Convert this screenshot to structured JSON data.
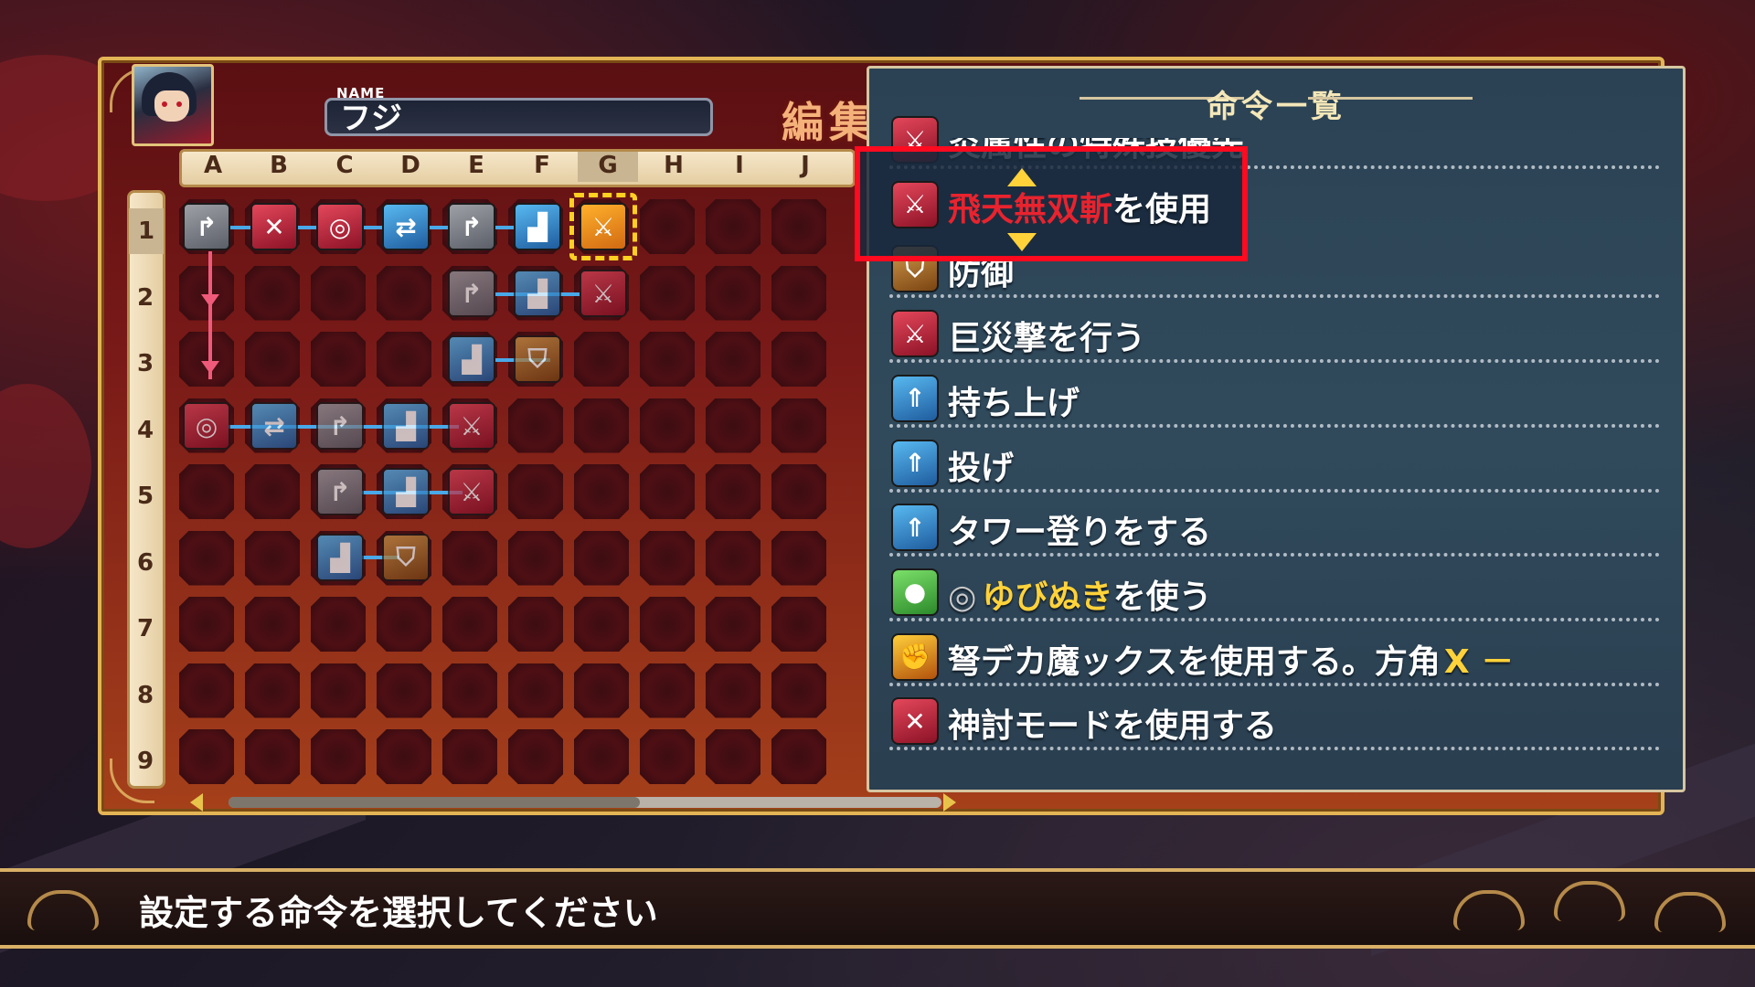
{
  "editor": {
    "name_label": "NAME",
    "name_value": "フジ",
    "title": "編集",
    "columns": [
      "A",
      "B",
      "C",
      "D",
      "E",
      "F",
      "G",
      "H",
      "I",
      "J"
    ],
    "rows": [
      "1",
      "2",
      "3",
      "4",
      "5",
      "6",
      "7",
      "8",
      "9"
    ],
    "selected_cell": "G1"
  },
  "command_list": {
    "title": "命令一覧",
    "items": [
      {
        "icon": "sword-icon",
        "prefix": "",
        "highlight": "",
        "text": "炎属性の特殊技優先"
      },
      {
        "icon": "sword-icon",
        "prefix": "",
        "highlight": "飛天無双斬",
        "text": "を使用"
      },
      {
        "icon": "shield-icon",
        "prefix": "",
        "highlight": "",
        "text": "防御"
      },
      {
        "icon": "sword-icon",
        "prefix": "",
        "highlight": "",
        "text": "巨災撃を行う"
      },
      {
        "icon": "lift-icon",
        "prefix": "",
        "highlight": "",
        "text": "持ち上げ"
      },
      {
        "icon": "lift-icon",
        "prefix": "",
        "highlight": "",
        "text": "投げ"
      },
      {
        "icon": "lift-icon",
        "prefix": "",
        "highlight": "",
        "text": "タワー登りをする"
      },
      {
        "icon": "bag-icon",
        "prefix": "",
        "highlight": "ゆびぬき",
        "text": "を使う"
      },
      {
        "icon": "muscle-icon",
        "prefix": "",
        "highlight": "",
        "text": "弩デカ魔ックスを使用する。方角",
        "suffix": "X －"
      },
      {
        "icon": "god-mode-icon",
        "prefix": "",
        "highlight": "",
        "text": "神討モードを使用する"
      }
    ]
  },
  "footer": {
    "message": "設定する命令を選択してください"
  },
  "colors": {
    "accent_gold": "#e3b455",
    "highlight_red": "#e8232e",
    "highlight_yellow": "#ffd23a",
    "selection_border": "#ff0a1f"
  }
}
